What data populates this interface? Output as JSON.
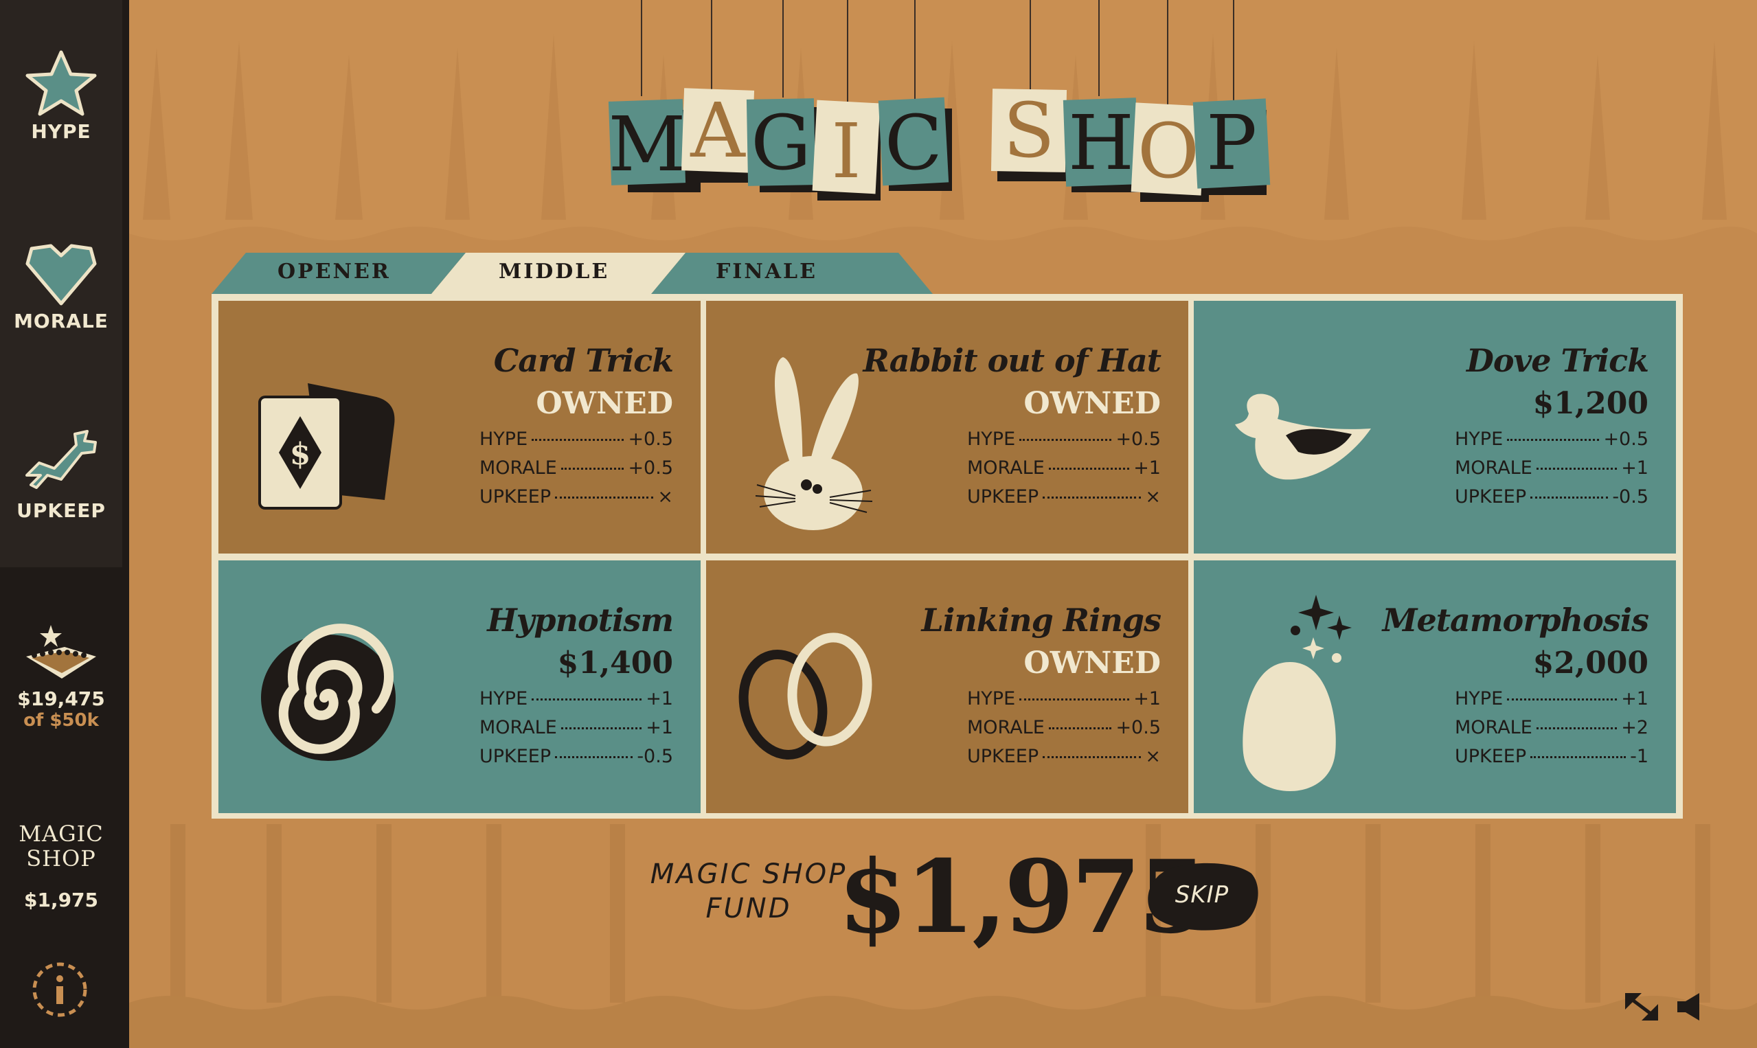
{
  "sidebar": {
    "stats": [
      {
        "label": "HYPE",
        "icon": "star-icon"
      },
      {
        "label": "MORALE",
        "icon": "heart-icon"
      },
      {
        "label": "UPKEEP",
        "icon": "wrench-icon"
      }
    ],
    "money": {
      "current": "$19,475",
      "goal": "of $50k",
      "icon": "stage-icon"
    },
    "mini_logo": {
      "line1": "MAGIC",
      "line2": "SHOP",
      "amount": "$1,975"
    },
    "info_icon": "info-icon"
  },
  "title": {
    "word1": [
      "M",
      "A",
      "G",
      "I",
      "C"
    ],
    "word2": [
      "S",
      "H",
      "O",
      "P"
    ]
  },
  "tabs": [
    {
      "label": "OPENER",
      "active": false
    },
    {
      "label": "MIDDLE",
      "active": true
    },
    {
      "label": "FINALE",
      "active": false
    }
  ],
  "tricks": [
    {
      "name": "Card Trick",
      "status": "OWNED",
      "icon": "playing-cards-icon",
      "stats": [
        {
          "label": "HYPE",
          "value": "+0.5"
        },
        {
          "label": "MORALE",
          "value": "+0.5"
        },
        {
          "label": "UPKEEP",
          "value": "×"
        }
      ]
    },
    {
      "name": "Rabbit out of Hat",
      "status": "OWNED",
      "icon": "rabbit-icon",
      "stats": [
        {
          "label": "HYPE",
          "value": "+0.5"
        },
        {
          "label": "MORALE",
          "value": "+1"
        },
        {
          "label": "UPKEEP",
          "value": "×"
        }
      ]
    },
    {
      "name": "Dove Trick",
      "status": "$1,200",
      "icon": "dove-icon",
      "stats": [
        {
          "label": "HYPE",
          "value": "+0.5"
        },
        {
          "label": "MORALE",
          "value": "+1"
        },
        {
          "label": "UPKEEP",
          "value": "-0.5"
        }
      ]
    },
    {
      "name": "Hypnotism",
      "status": "$1,400",
      "icon": "spiral-icon",
      "stats": [
        {
          "label": "HYPE",
          "value": "+1"
        },
        {
          "label": "MORALE",
          "value": "+1"
        },
        {
          "label": "UPKEEP",
          "value": "-0.5"
        }
      ]
    },
    {
      "name": "Linking Rings",
      "status": "OWNED",
      "icon": "linking-rings-icon",
      "stats": [
        {
          "label": "HYPE",
          "value": "+1"
        },
        {
          "label": "MORALE",
          "value": "+0.5"
        },
        {
          "label": "UPKEEP",
          "value": "×"
        }
      ]
    },
    {
      "name": "Metamorphosis",
      "status": "$2,000",
      "icon": "egg-sparkle-icon",
      "stats": [
        {
          "label": "HYPE",
          "value": "+1"
        },
        {
          "label": "MORALE",
          "value": "+2"
        },
        {
          "label": "UPKEEP",
          "value": "-1"
        }
      ]
    }
  ],
  "fund": {
    "label_line1": "MAGIC SHOP",
    "label_line2": "FUND",
    "amount": "$1,975"
  },
  "skip": {
    "label": "SKIP"
  },
  "corner_icons": [
    "fullscreen-icon",
    "sound-icon"
  ],
  "colors": {
    "brown": "#a2743d",
    "teal": "#5a8f87",
    "cream": "#ede3c6",
    "dark": "#1f1a17",
    "bg": "#c98f52"
  }
}
